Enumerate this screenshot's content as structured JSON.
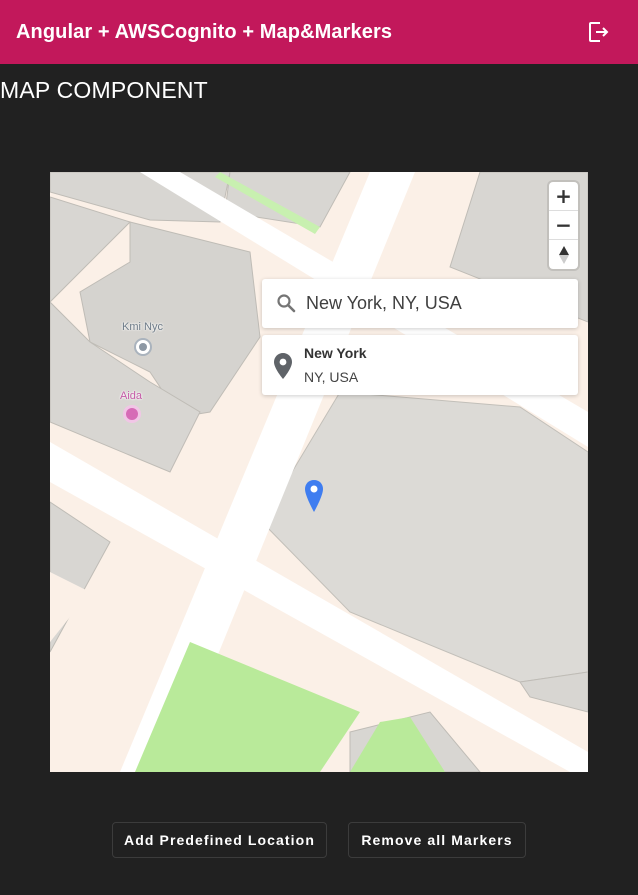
{
  "app": {
    "title": "Angular + AWSCognito + Map&Markers",
    "logout_icon": "logout-icon",
    "toolbar_color": "#c2185b"
  },
  "page": {
    "section_title": "MAP COMPONENT"
  },
  "map": {
    "zoom_in_label": "+",
    "zoom_out_label": "−",
    "compass_icon": "compass-icon",
    "search": {
      "value": "New York, NY, USA",
      "icon": "search-icon"
    },
    "suggestion": {
      "name": "New York",
      "address": "NY, USA",
      "icon": "location-pin-icon"
    },
    "pois": [
      {
        "label": "Kmi Nyc",
        "icon": "circle-poi-icon",
        "color": "#7d8a99"
      },
      {
        "label": "Aida",
        "icon": "pink-poi-icon",
        "color": "#d66bb6"
      }
    ],
    "marker": {
      "icon": "map-marker-icon",
      "color": "#3f7df0"
    }
  },
  "actions": {
    "add_location_label": "Add Predefined Location",
    "remove_markers_label": "Remove all Markers"
  }
}
